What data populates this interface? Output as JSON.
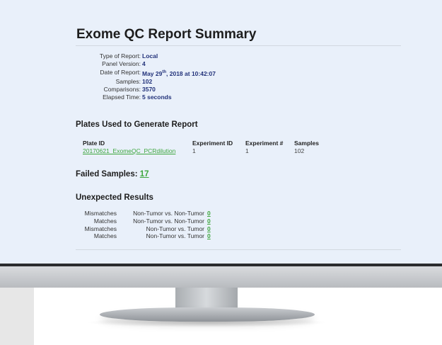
{
  "report": {
    "title": "Exome QC Report Summary",
    "meta": [
      {
        "label": "Type of Report:",
        "value": "Local"
      },
      {
        "label": "Panel Version:",
        "value": "4"
      },
      {
        "label": "Date of Report:",
        "value_pre": "May 29",
        "value_sup": "th",
        "value_post": ", 2018 at 10:42:07"
      },
      {
        "label": "Samples:",
        "value": "102"
      },
      {
        "label": "Comparisons:",
        "value": "3570"
      },
      {
        "label": "Elapsed Time:",
        "value": "5 seconds"
      }
    ],
    "plates": {
      "heading": "Plates Used to Generate Report",
      "columns": [
        "Plate ID",
        "Experiment ID",
        "Experiment #",
        "Samples"
      ],
      "rows": [
        {
          "plate_id": "20170621_ExomeQC_PCRdilution",
          "experiment_id": "1",
          "experiment_num": "1",
          "samples": "102"
        }
      ]
    },
    "failed": {
      "label": "Failed Samples:",
      "count": "17"
    },
    "unexpected": {
      "heading": "Unexpected Results",
      "rows": [
        {
          "type": "Mismatches",
          "comparison": "Non-Tumor vs. Non-Tumor",
          "count": "0"
        },
        {
          "type": "Matches",
          "comparison": "Non-Tumor vs. Non-Tumor",
          "count": "0"
        },
        {
          "type": "Mismatches",
          "comparison": "Non-Tumor vs. Tumor",
          "count": "0"
        },
        {
          "type": "Matches",
          "comparison": "Non-Tumor vs. Tumor",
          "count": "0"
        }
      ]
    }
  },
  "colors": {
    "screen_bg": "#e9f0fa",
    "link": "#3ea63e",
    "meta_value": "#22327a",
    "bezel": "#2b2c2e"
  }
}
